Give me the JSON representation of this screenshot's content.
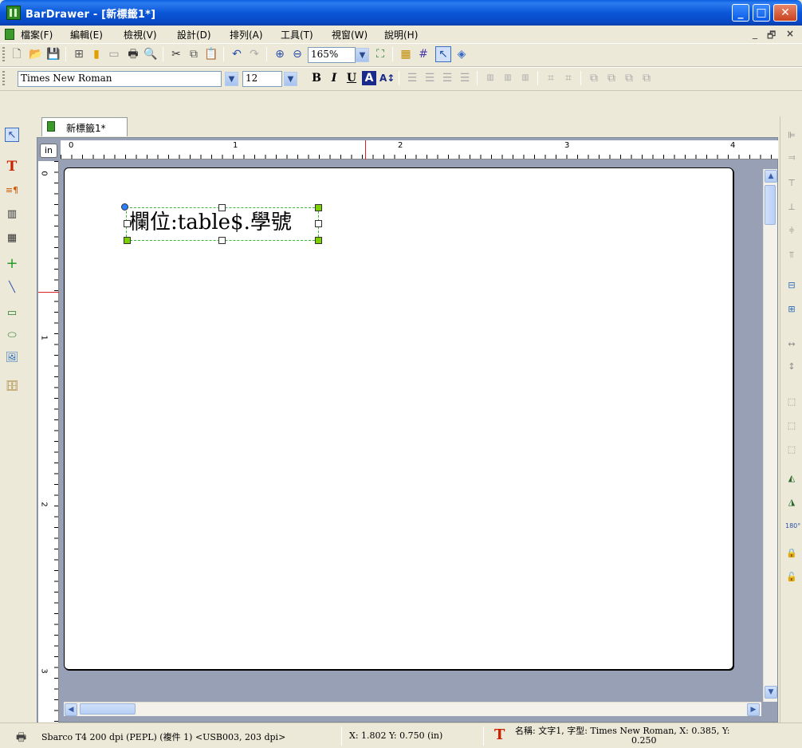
{
  "window": {
    "title": "BarDrawer - [新標籤1*]",
    "min_glyph": "_",
    "max_glyph": "□",
    "close_glyph": "✕"
  },
  "menu": {
    "items": [
      "檔案(F)",
      "編輯(E)",
      "檢視(V)",
      "設計(D)",
      "排列(A)",
      "工具(T)",
      "視窗(W)",
      "說明(H)"
    ],
    "mdi_min": "_",
    "mdi_restore": "🗗",
    "mdi_close": "×"
  },
  "toolbar": {
    "zoom_value": "165%"
  },
  "format_bar": {
    "font_name": "Times New Roman",
    "font_size": "12",
    "bold": "B",
    "italic": "I",
    "underline": "U",
    "text_color": "A",
    "font_scale": "A↕"
  },
  "document": {
    "tab_label": "新標籤1*",
    "ruler_unit": "in",
    "h_ruler_numbers": [
      "0",
      "1",
      "2",
      "3",
      "4"
    ],
    "v_ruler_numbers": [
      "0",
      "1",
      "2",
      "3"
    ],
    "text_object": "欄位:table$.學號"
  },
  "status": {
    "printer": "Sbarco T4 200 dpi (PEPL) (複件 1) <USB003, 203 dpi>",
    "cursor": "X: 1.802  Y: 0.750 (in)",
    "object_info": "名稱: 文字1, 字型: Times New Roman, X: 0.385, Y:",
    "object_info_2": "0.250"
  },
  "colors": {
    "titlebar": "#0a57d8",
    "chrome": "#ece9d8",
    "canvas_bg": "#97a0b4",
    "selection_green": "#7ccf00",
    "tool_text_red": "#cc2200"
  }
}
